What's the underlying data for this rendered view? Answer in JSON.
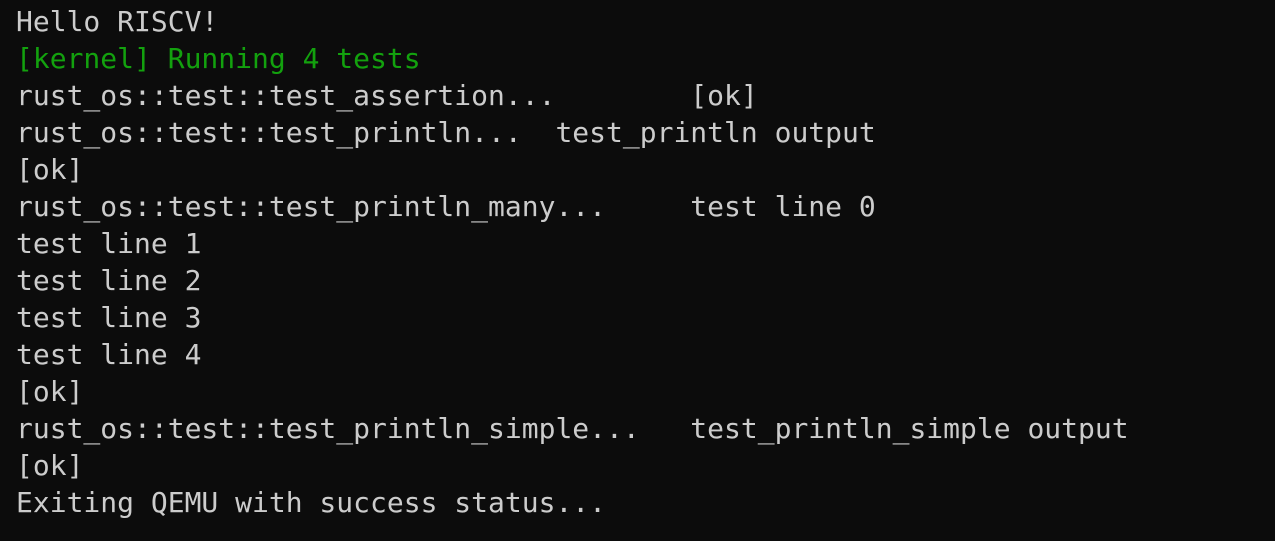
{
  "terminal": {
    "background": "#0c0c0c",
    "foreground": "#cccccc",
    "accent_green": "#13a10e",
    "lines": [
      {
        "text": "Hello RISCV!",
        "color": "default"
      },
      {
        "text": "[kernel] Running 4 tests",
        "color": "green"
      },
      {
        "text": "rust_os::test::test_assertion...        [ok]",
        "color": "default"
      },
      {
        "text": "rust_os::test::test_println...  test_println output",
        "color": "default"
      },
      {
        "text": "[ok]",
        "color": "default"
      },
      {
        "text": "rust_os::test::test_println_many...     test line 0",
        "color": "default"
      },
      {
        "text": "test line 1",
        "color": "default"
      },
      {
        "text": "test line 2",
        "color": "default"
      },
      {
        "text": "test line 3",
        "color": "default"
      },
      {
        "text": "test line 4",
        "color": "default"
      },
      {
        "text": "[ok]",
        "color": "default"
      },
      {
        "text": "rust_os::test::test_println_simple...   test_println_simple output",
        "color": "default"
      },
      {
        "text": "[ok]",
        "color": "default"
      },
      {
        "text": "Exiting QEMU with success status...",
        "color": "default"
      }
    ]
  }
}
